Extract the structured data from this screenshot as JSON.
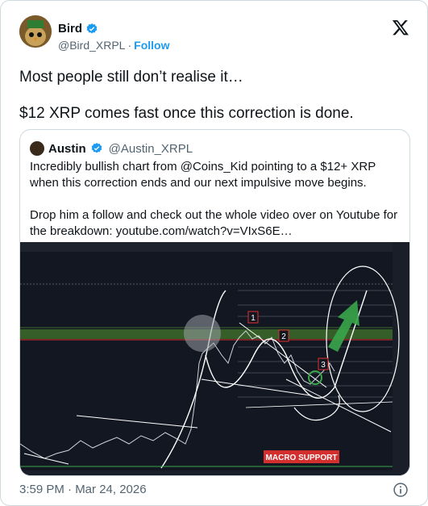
{
  "author": {
    "name": "Bird",
    "handle": "@Bird_XRPL",
    "follow_label": "Follow",
    "separator": "·"
  },
  "tweet": {
    "line1": "Most people still don’t realise it…",
    "line2": "$12 XRP comes fast once this correction is done."
  },
  "quoted": {
    "name": "Austin",
    "handle": "@Austin_XRPL",
    "para1": "Incredibly bullish chart from @Coins_Kid pointing to a $12+ XRP when this correction ends and our next impulsive move begins.",
    "para2": "Drop him a follow and check out the whole video over on Youtube for the breakdown: youtube.com/watch?v=VIxS6E…"
  },
  "chart": {
    "macro_label": "MACRO SUPPORT",
    "wave_labels": [
      "1",
      "2",
      "3"
    ],
    "colors": {
      "bg": "#131722",
      "green_band": "#3d6b2a",
      "red_line": "#e0302f",
      "arrow": "#3aa64a",
      "macro": "#d32f2f"
    }
  },
  "timestamp": "3:59 PM · Mar 24, 2026"
}
